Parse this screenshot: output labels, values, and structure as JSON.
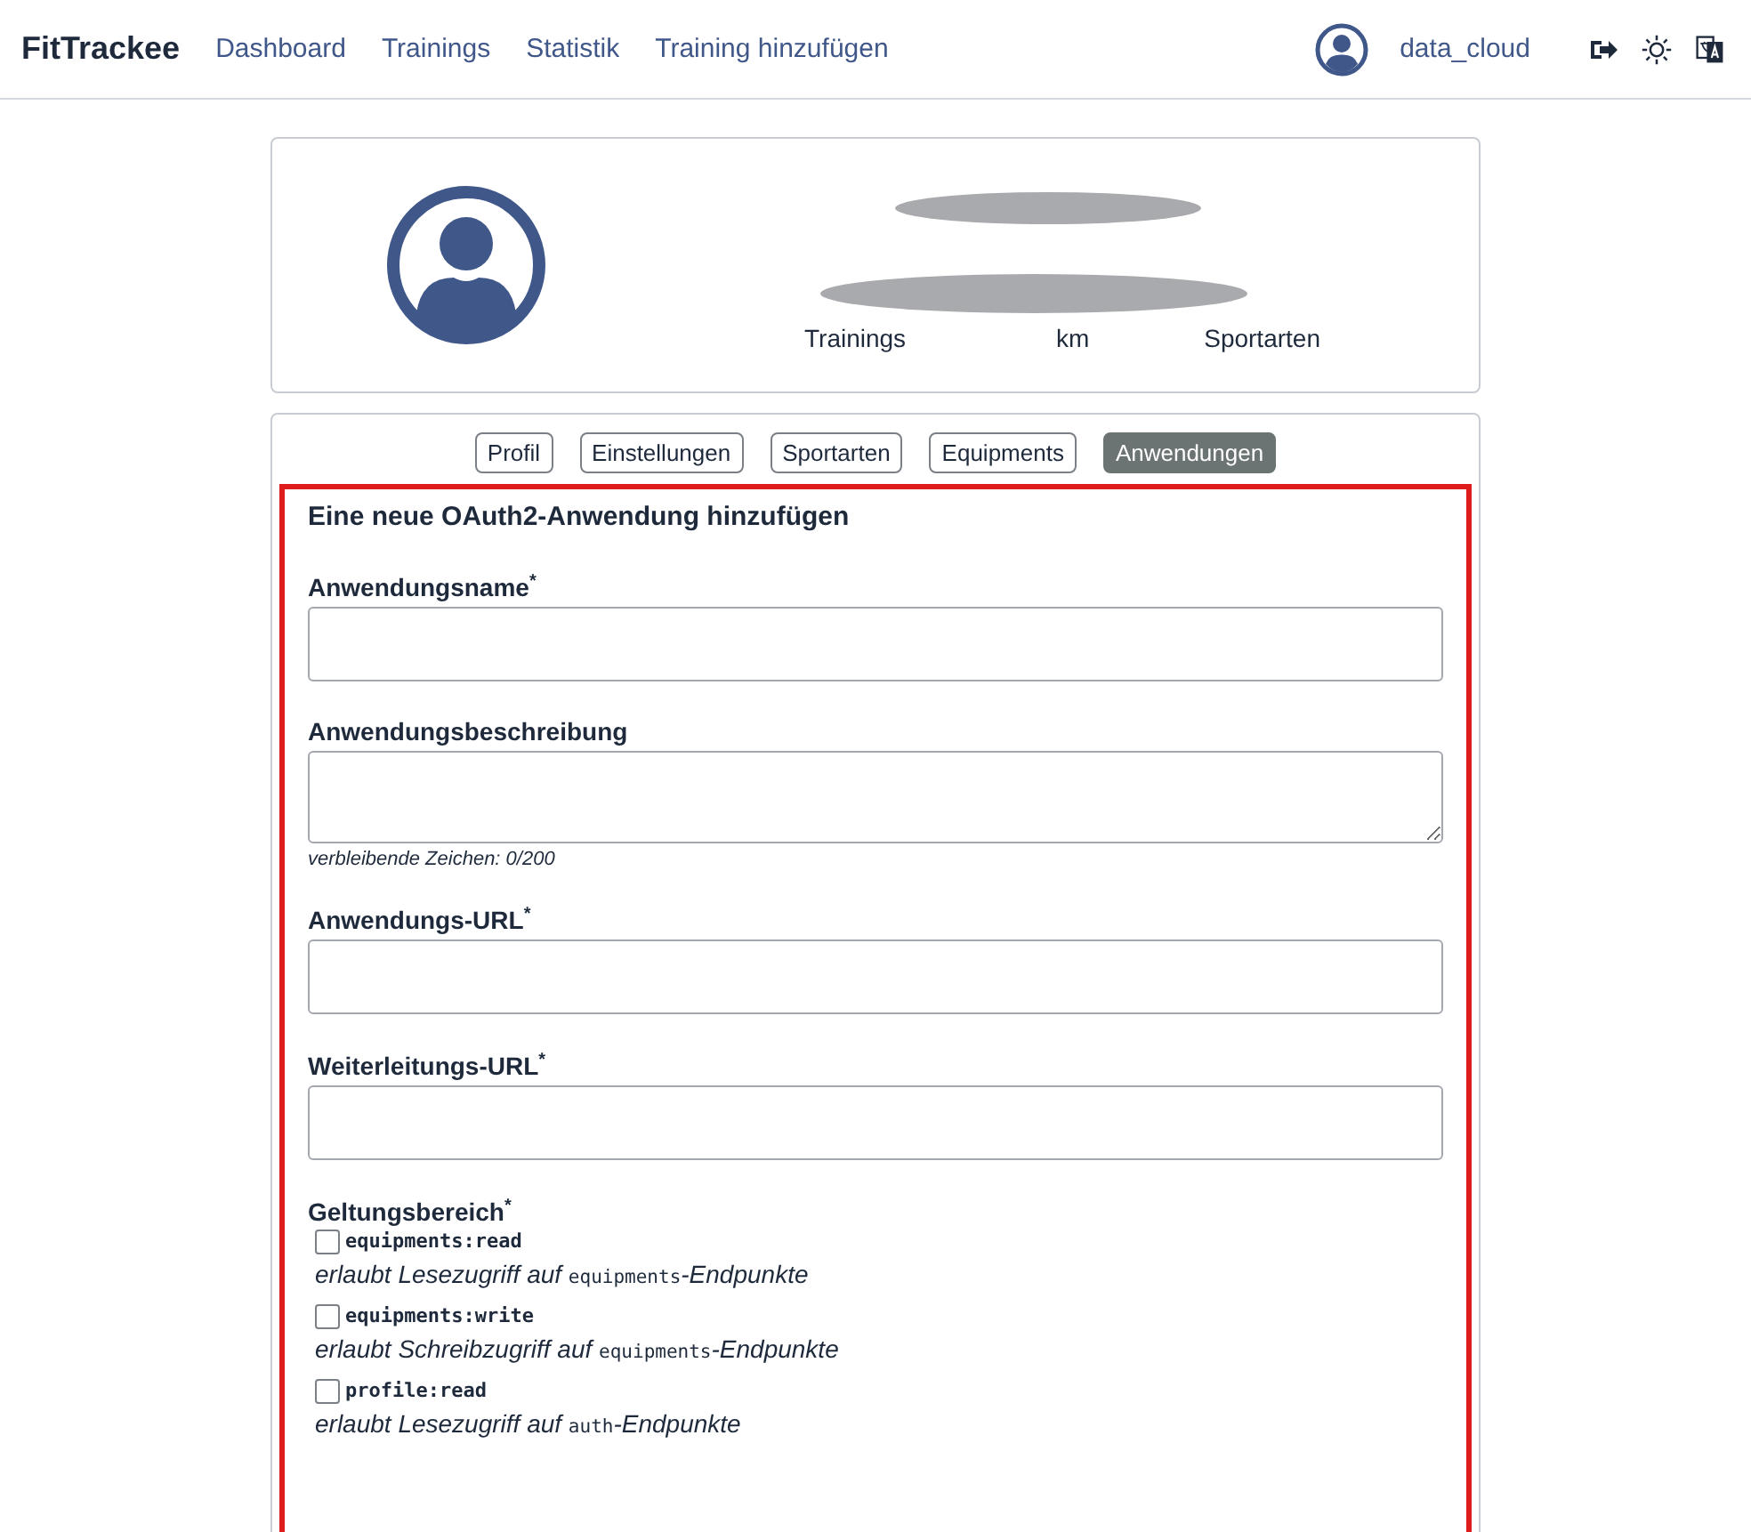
{
  "navbar": {
    "brand": "FitTrackee",
    "links": [
      "Dashboard",
      "Trainings",
      "Statistik",
      "Training hinzufügen"
    ],
    "username": "data_cloud"
  },
  "profile": {
    "stats": [
      {
        "label": "Trainings"
      },
      {
        "label": "km"
      },
      {
        "label": "Sportarten"
      }
    ]
  },
  "tabs": [
    {
      "label": "Profil",
      "selected": false
    },
    {
      "label": "Einstellungen",
      "selected": false
    },
    {
      "label": "Sportarten",
      "selected": false
    },
    {
      "label": "Equipments",
      "selected": false
    },
    {
      "label": "Anwendungen",
      "selected": true
    }
  ],
  "form": {
    "title": "Eine neue OAuth2-Anwendung hinzufügen",
    "fields": [
      {
        "kind": "input",
        "label": "Anwendungsname$^{*}$"
      },
      {
        "kind": "textarea",
        "label": "Anwendungsbeschreibung",
        "hint": "verbleibende Zeichen: 0/200"
      },
      {
        "kind": "input",
        "label": "Anwendungs-URL$^{*}$"
      },
      {
        "kind": "input",
        "label": "Weiterleitungs-URL$^{*}$"
      }
    ],
    "scope_label": "Geltungsbereich$^{*}$",
    "scopes": [
      {
        "name": "equipments:read",
        "checked": false,
        "desc_before": "erlaubt Lesezugriff auf ",
        "desc_code": "equipments",
        "desc_after": "-Endpunkte"
      },
      {
        "name": "equipments:write",
        "checked": false,
        "desc_before": "erlaubt Schreibzugriff auf ",
        "desc_code": "equipments",
        "desc_after": "-Endpunkte"
      },
      {
        "name": "profile:read",
        "checked": false,
        "desc_before": "erlaubt Lesezugriff auf ",
        "desc_code": "auth",
        "desc_after": "-Endpunkte"
      }
    ]
  }
}
